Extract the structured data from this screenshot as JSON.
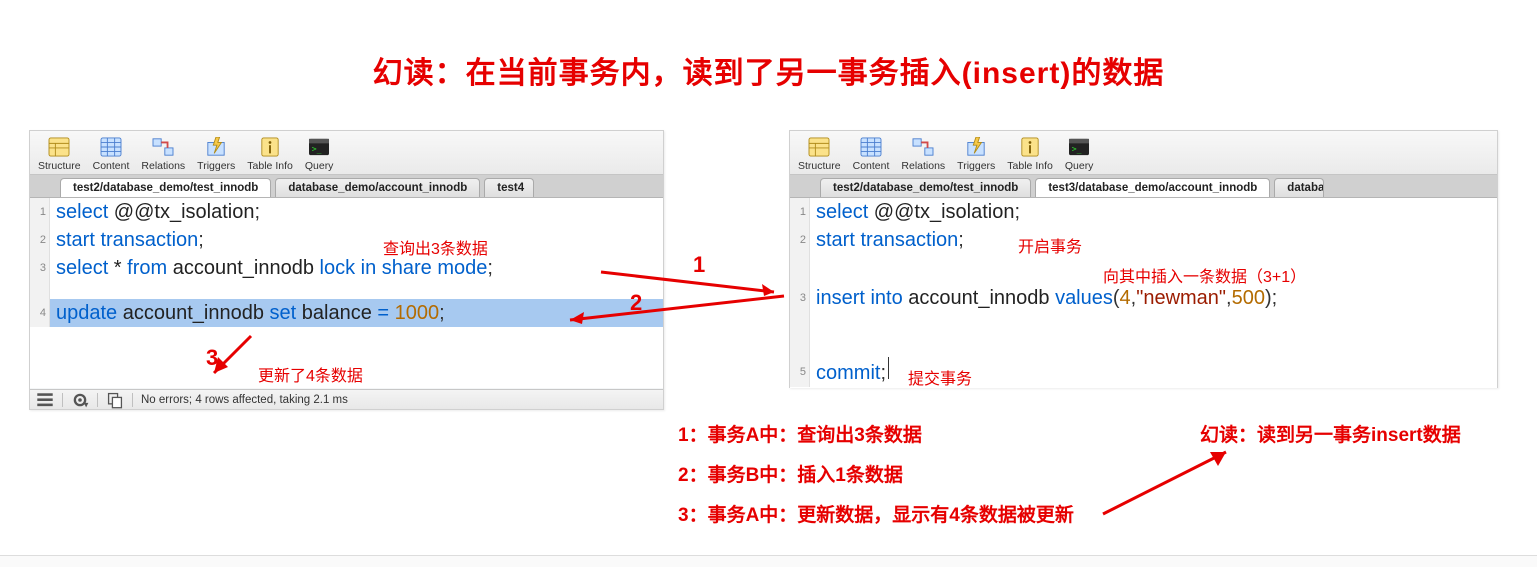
{
  "title": "幻读：在当前事务内，读到了另一事务插入(insert)的数据",
  "toolbar": {
    "structure": "Structure",
    "content": "Content",
    "relations": "Relations",
    "triggers": "Triggers",
    "table_info": "Table Info",
    "query": "Query"
  },
  "leftTabs": {
    "t1": "test2/database_demo/test_innodb",
    "t2": "database_demo/account_innodb",
    "t3": "test4"
  },
  "rightTabs": {
    "t1": "test2/database_demo/test_innodb",
    "t2": "test3/database_demo/account_innodb",
    "t3": "databas"
  },
  "leftCode": {
    "l1_kw1": "select",
    "l1_id": " @@tx_isolation",
    "l1_p": ";",
    "l2_kw": "start transaction",
    "l2_p": ";",
    "l3_kw1": "select",
    "l3_star": " * ",
    "l3_from": "from",
    "l3_tbl": " account_innodb ",
    "l3_lock": "lock in share mode",
    "l3_p": ";",
    "l4_kw": "update",
    "l4_tbl": " account_innodb ",
    "l4_set": "set",
    "l4_col": " balance ",
    "l4_eq": "= ",
    "l4_num": "1000",
    "l4_p": ";"
  },
  "rightCode": {
    "l1_kw1": "select",
    "l1_id": " @@tx_isolation",
    "l1_p": ";",
    "l2_kw": "start transaction",
    "l2_p": ";",
    "l3_kw": "insert into",
    "l3_tbl": " account_innodb ",
    "l3_vals": "values",
    "l3_open": "(",
    "l3_n1": "4",
    "l3_c1": ",",
    "l3_str": "\"newman\"",
    "l3_c2": ",",
    "l3_n2": "500",
    "l3_close": ")",
    "l3_p": ";",
    "l5_kw": "commit",
    "l5_p": ";"
  },
  "status": "No errors; 4 rows affected, taking 2.1 ms",
  "annot": {
    "select3": "查询出3条数据",
    "updated4": "更新了4条数据",
    "openTx": "开启事务",
    "insertOne": "向其中插入一条数据（3+1）",
    "commit": "提交事务"
  },
  "step": {
    "n1": "1",
    "n2": "2",
    "n3": "3"
  },
  "explain": {
    "e1": "1：事务A中：查询出3条数据",
    "e2": "2：事务B中：插入1条数据",
    "e3": "3：事务A中：更新数据，显示有4条数据被更新",
    "e4": "幻读：读到另一事务insert数据"
  }
}
